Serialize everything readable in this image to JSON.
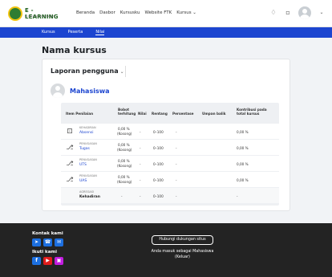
{
  "brand": {
    "title": "E - LEARNING",
    "subtitle": "Universitas Islam Negeri..."
  },
  "nav": [
    "Beranda",
    "Dasbor",
    "Kursusku",
    "Website FTK",
    "Kursus"
  ],
  "tabs": [
    "Kursus",
    "Peserta",
    "Nilai"
  ],
  "page_title": "Nama kursus",
  "report_selector": "Laporan pengguna",
  "user_name": "Mahasiswa",
  "grade_table": {
    "headers": {
      "item": "Item Penilaian",
      "weight": "Bobot terhitung",
      "grade": "Nilai",
      "range": "Rentang",
      "percent": "Persentase",
      "feedback": "Umpan balik",
      "contribution": "Kontribusi pada total kursus"
    },
    "rows": [
      {
        "type": "KEHADIRAN",
        "name": "Absensi",
        "weight": "0,00 %",
        "weight_note": "(Kosong)",
        "grade": "-",
        "range": "0–100",
        "percent": "-",
        "feedback": "",
        "contribution": "0,00 %",
        "icon": "attendance-icon"
      },
      {
        "type": "PENUGASAN",
        "name": "Tugas",
        "weight": "0,00 %",
        "weight_note": "(Kosong)",
        "grade": "-",
        "range": "0–100",
        "percent": "-",
        "feedback": "",
        "contribution": "0,00 %",
        "icon": "assignment-icon"
      },
      {
        "type": "PENUGASAN",
        "name": "UTS",
        "weight": "0,00 %",
        "weight_note": "(Kosong)",
        "grade": "-",
        "range": "0–100",
        "percent": "-",
        "feedback": "",
        "contribution": "0,00 %",
        "icon": "assignment-icon"
      },
      {
        "type": "PENUGASAN",
        "name": "UAS",
        "weight": "0,00 %",
        "weight_note": "(Kosong)",
        "grade": "-",
        "range": "0–100",
        "percent": "-",
        "feedback": "",
        "contribution": "0,00 %",
        "icon": "assignment-icon"
      },
      {
        "type": "AGREGASI",
        "name": "Kehadiran",
        "weight": "-",
        "weight_note": "",
        "grade": "-",
        "range": "0–100",
        "percent": "-",
        "feedback": "",
        "contribution": "-",
        "icon": ""
      }
    ]
  },
  "footer": {
    "contact_label": "Kontak kami",
    "follow_label": "Ikuti kami",
    "support_button": "Hubungi dukungan situs",
    "logged_in_text": "Anda masuk sebagai Mahasiswa",
    "logout_text": "(Keluar)"
  },
  "colors": {
    "primary": "#1c45d0",
    "footer": "#232323"
  }
}
